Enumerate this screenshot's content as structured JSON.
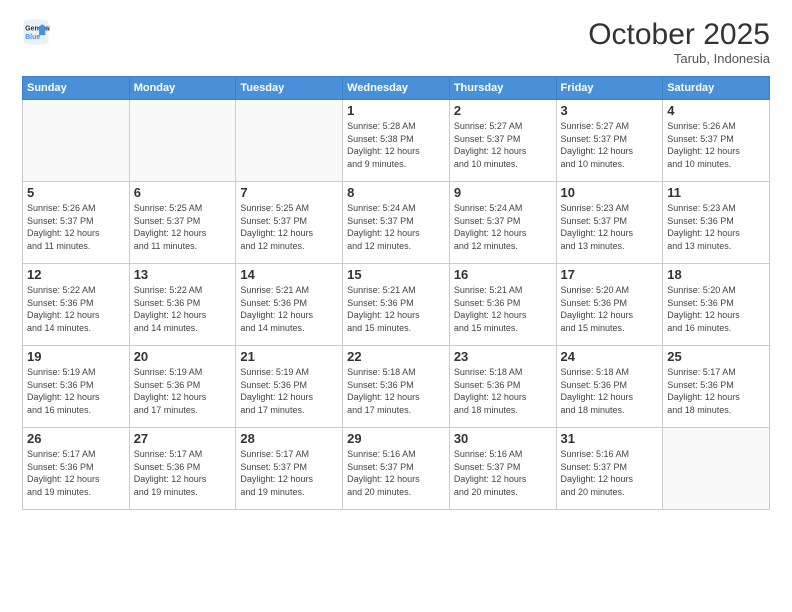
{
  "logo": {
    "line1": "General",
    "line2": "Blue"
  },
  "header": {
    "title": "October 2025",
    "subtitle": "Tarub, Indonesia"
  },
  "weekdays": [
    "Sunday",
    "Monday",
    "Tuesday",
    "Wednesday",
    "Thursday",
    "Friday",
    "Saturday"
  ],
  "weeks": [
    [
      {
        "day": "",
        "info": ""
      },
      {
        "day": "",
        "info": ""
      },
      {
        "day": "",
        "info": ""
      },
      {
        "day": "1",
        "info": "Sunrise: 5:28 AM\nSunset: 5:38 PM\nDaylight: 12 hours\nand 9 minutes."
      },
      {
        "day": "2",
        "info": "Sunrise: 5:27 AM\nSunset: 5:37 PM\nDaylight: 12 hours\nand 10 minutes."
      },
      {
        "day": "3",
        "info": "Sunrise: 5:27 AM\nSunset: 5:37 PM\nDaylight: 12 hours\nand 10 minutes."
      },
      {
        "day": "4",
        "info": "Sunrise: 5:26 AM\nSunset: 5:37 PM\nDaylight: 12 hours\nand 10 minutes."
      }
    ],
    [
      {
        "day": "5",
        "info": "Sunrise: 5:26 AM\nSunset: 5:37 PM\nDaylight: 12 hours\nand 11 minutes."
      },
      {
        "day": "6",
        "info": "Sunrise: 5:25 AM\nSunset: 5:37 PM\nDaylight: 12 hours\nand 11 minutes."
      },
      {
        "day": "7",
        "info": "Sunrise: 5:25 AM\nSunset: 5:37 PM\nDaylight: 12 hours\nand 12 minutes."
      },
      {
        "day": "8",
        "info": "Sunrise: 5:24 AM\nSunset: 5:37 PM\nDaylight: 12 hours\nand 12 minutes."
      },
      {
        "day": "9",
        "info": "Sunrise: 5:24 AM\nSunset: 5:37 PM\nDaylight: 12 hours\nand 12 minutes."
      },
      {
        "day": "10",
        "info": "Sunrise: 5:23 AM\nSunset: 5:37 PM\nDaylight: 12 hours\nand 13 minutes."
      },
      {
        "day": "11",
        "info": "Sunrise: 5:23 AM\nSunset: 5:36 PM\nDaylight: 12 hours\nand 13 minutes."
      }
    ],
    [
      {
        "day": "12",
        "info": "Sunrise: 5:22 AM\nSunset: 5:36 PM\nDaylight: 12 hours\nand 14 minutes."
      },
      {
        "day": "13",
        "info": "Sunrise: 5:22 AM\nSunset: 5:36 PM\nDaylight: 12 hours\nand 14 minutes."
      },
      {
        "day": "14",
        "info": "Sunrise: 5:21 AM\nSunset: 5:36 PM\nDaylight: 12 hours\nand 14 minutes."
      },
      {
        "day": "15",
        "info": "Sunrise: 5:21 AM\nSunset: 5:36 PM\nDaylight: 12 hours\nand 15 minutes."
      },
      {
        "day": "16",
        "info": "Sunrise: 5:21 AM\nSunset: 5:36 PM\nDaylight: 12 hours\nand 15 minutes."
      },
      {
        "day": "17",
        "info": "Sunrise: 5:20 AM\nSunset: 5:36 PM\nDaylight: 12 hours\nand 15 minutes."
      },
      {
        "day": "18",
        "info": "Sunrise: 5:20 AM\nSunset: 5:36 PM\nDaylight: 12 hours\nand 16 minutes."
      }
    ],
    [
      {
        "day": "19",
        "info": "Sunrise: 5:19 AM\nSunset: 5:36 PM\nDaylight: 12 hours\nand 16 minutes."
      },
      {
        "day": "20",
        "info": "Sunrise: 5:19 AM\nSunset: 5:36 PM\nDaylight: 12 hours\nand 17 minutes."
      },
      {
        "day": "21",
        "info": "Sunrise: 5:19 AM\nSunset: 5:36 PM\nDaylight: 12 hours\nand 17 minutes."
      },
      {
        "day": "22",
        "info": "Sunrise: 5:18 AM\nSunset: 5:36 PM\nDaylight: 12 hours\nand 17 minutes."
      },
      {
        "day": "23",
        "info": "Sunrise: 5:18 AM\nSunset: 5:36 PM\nDaylight: 12 hours\nand 18 minutes."
      },
      {
        "day": "24",
        "info": "Sunrise: 5:18 AM\nSunset: 5:36 PM\nDaylight: 12 hours\nand 18 minutes."
      },
      {
        "day": "25",
        "info": "Sunrise: 5:17 AM\nSunset: 5:36 PM\nDaylight: 12 hours\nand 18 minutes."
      }
    ],
    [
      {
        "day": "26",
        "info": "Sunrise: 5:17 AM\nSunset: 5:36 PM\nDaylight: 12 hours\nand 19 minutes."
      },
      {
        "day": "27",
        "info": "Sunrise: 5:17 AM\nSunset: 5:36 PM\nDaylight: 12 hours\nand 19 minutes."
      },
      {
        "day": "28",
        "info": "Sunrise: 5:17 AM\nSunset: 5:37 PM\nDaylight: 12 hours\nand 19 minutes."
      },
      {
        "day": "29",
        "info": "Sunrise: 5:16 AM\nSunset: 5:37 PM\nDaylight: 12 hours\nand 20 minutes."
      },
      {
        "day": "30",
        "info": "Sunrise: 5:16 AM\nSunset: 5:37 PM\nDaylight: 12 hours\nand 20 minutes."
      },
      {
        "day": "31",
        "info": "Sunrise: 5:16 AM\nSunset: 5:37 PM\nDaylight: 12 hours\nand 20 minutes."
      },
      {
        "day": "",
        "info": ""
      }
    ]
  ]
}
